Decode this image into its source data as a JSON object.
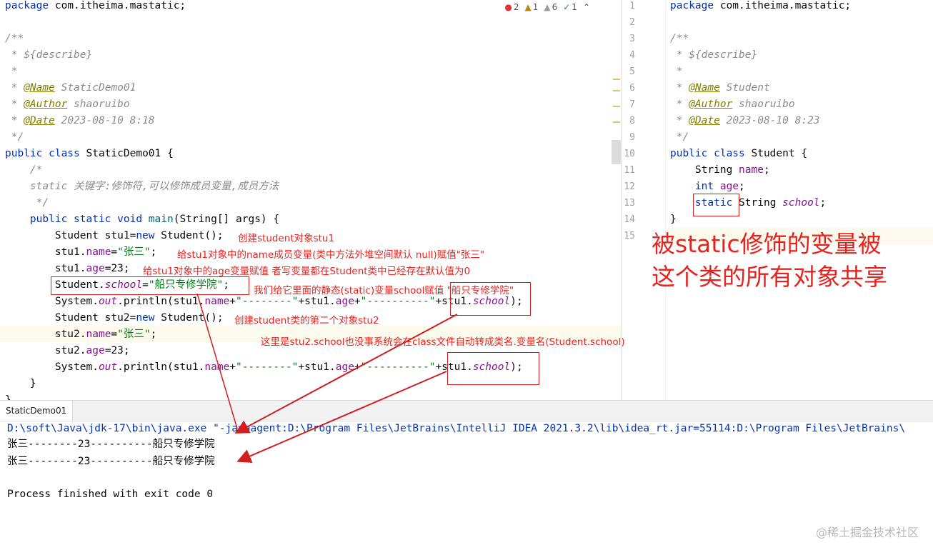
{
  "left_editor": {
    "inspection": {
      "errors": "2",
      "warnings": "1",
      "weak_warnings": "6",
      "ok": "1"
    },
    "lines": {
      "l1_kw": "package",
      "l1_rest": " com.itheima.mastatic;",
      "l3": "/**",
      "l4": " * ${describe}",
      "l5": " *",
      "l6_pre": " * ",
      "l6_tag": "@Name",
      "l6_val": " StaticDemo01",
      "l7_pre": " * ",
      "l7_tag": "@Author",
      "l7_val": " shaoruibo",
      "l8_pre": " * ",
      "l8_tag": "@Date",
      "l8_val": " 2023-08-10 8:18",
      "l9": " */",
      "l10_kw": "public class",
      "l10_rest": " StaticDemo01 {",
      "l11": "    /*",
      "l12": "    static 关键字:修饰符,可以修饰成员变量,成员方法",
      "l13": "     */",
      "l14_kw": "    public static void ",
      "l14_m": "main",
      "l14_rest": "(String[] args) {",
      "l15_a": "        Student stu1=",
      "l15_kw": "new",
      "l15_b": " Student();",
      "l16_a": "        stu1.",
      "l16_f": "name",
      "l16_b": "=",
      "l16_s": "\"张三\"",
      "l16_c": ";",
      "l17_a": "        stu1.",
      "l17_f": "age",
      "l17_b": "=23;",
      "l18_a": "        Student.",
      "l18_f": "school",
      "l18_b": "=",
      "l18_s": "\"船只专修学院\"",
      "l18_c": ";",
      "l19_a": "        System.",
      "l19_o": "out",
      "l19_b": ".println(stu1.",
      "l19_f1": "name",
      "l19_c": "+",
      "l19_s1": "\"--------\"",
      "l19_d": "+stu1.",
      "l19_f2": "age",
      "l19_e": "+",
      "l19_s2": "\"----------\"",
      "l19_g": "+stu1.",
      "l19_f3": "school",
      "l19_h": ");",
      "l20_a": "        Student stu2=",
      "l20_kw": "new",
      "l20_b": " Student();",
      "l21_a": "        stu2.",
      "l21_f": "name",
      "l21_b": "=",
      "l21_s": "\"张三\"",
      "l21_c": ";",
      "l22_a": "        stu2.",
      "l22_f": "age",
      "l22_b": "=23;",
      "l23_a": "        System.",
      "l23_o": "out",
      "l23_b": ".println(stu1.",
      "l23_f1": "name",
      "l23_c": "+",
      "l23_s1": "\"--------\"",
      "l23_d": "+stu1.",
      "l23_f2": "age",
      "l23_e": "+",
      "l23_s2": "\"----------\"",
      "l23_g": "+stu1.",
      "l23_f3": "school",
      "l23_h": ");",
      "l24": "    }",
      "l25": "}"
    }
  },
  "right_editor": {
    "line_numbers": [
      "1",
      "2",
      "3",
      "4",
      "5",
      "6",
      "7",
      "8",
      "9",
      "10",
      "11",
      "12",
      "13",
      "14",
      "15"
    ],
    "lines": {
      "r1_kw": "package",
      "r1_rest": " com.itheima.mastatic;",
      "r3": "/**",
      "r4": " * ${describe}",
      "r5": " *",
      "r6_pre": " * ",
      "r6_tag": "@Name",
      "r6_val": " Student",
      "r7_pre": " * ",
      "r7_tag": "@Author",
      "r7_val": " shaoruibo",
      "r8_pre": " * ",
      "r8_tag": "@Date",
      "r8_val": " 2023-08-10 8:23",
      "r9": " */",
      "r10_kw": "public class",
      "r10_rest": " Student {",
      "r11_a": "    String ",
      "r11_f": "name",
      "r11_b": ";",
      "r12_kw": "    int",
      "r12_a": " ",
      "r12_f": "age",
      "r12_b": ";",
      "r13_kw": "static",
      "r13_a": " String ",
      "r13_f": "school",
      "r13_b": ";",
      "r14": "}"
    }
  },
  "annotations": {
    "a1": "创建student对象stu1",
    "a2": "给stu1对象中的name成员变量(类中方法外堆空间默认 null)赋值\"张三\"",
    "a3": "给stu1对象中的age变量赋值 者写变量都在Student类中已经存在默认值为0",
    "a4": "我们给它里面的静态(static)变量school赋值 \"船只专修学院\"",
    "a5": "创建student类的第二个对象stu2",
    "a6": "这里是stu2.school也没事系统会在class文件自动转成类名.变量名(Student.school)",
    "big_line1": "被static修饰的变量被",
    "big_line2": "这个类的所有对象共享"
  },
  "console": {
    "tab_label": "StaticDemo01",
    "command": "D:\\soft\\Java\\jdk-17\\bin\\java.exe \"-javaagent:D:\\Program Files\\JetBrains\\IntelliJ IDEA 2021.3.2\\lib\\idea_rt.jar=55114:D:\\Program Files\\JetBrains\\",
    "out1_a": "张三--------23----------",
    "out1_b": "船只专修学院",
    "out2_a": "张三--------23----------",
    "out2_b": "船只专修学院",
    "exit": "Process finished with exit code 0"
  },
  "watermark": "@稀土掘金技术社区"
}
